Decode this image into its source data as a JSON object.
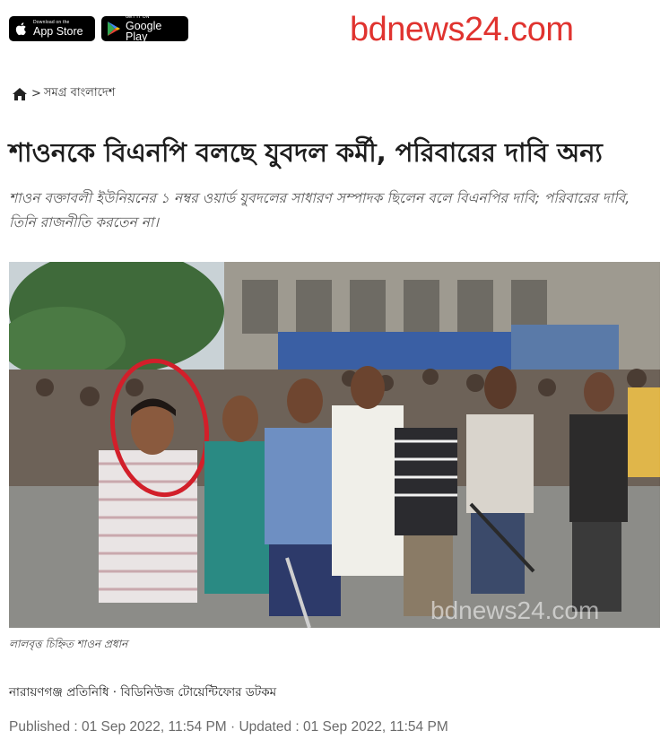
{
  "header": {
    "app_store": {
      "small": "Download on the",
      "big": "App Store"
    },
    "google_play": {
      "small": "GET IT ON",
      "big": "Google Play"
    },
    "logo_text": "bdnews24.com",
    "logo_color": "#e0332f"
  },
  "breadcrumb": {
    "home_icon": "home-icon",
    "separator": ">",
    "section": "সমগ্র বাংলাদেশ"
  },
  "article": {
    "headline": "শাওনকে বিএনপি বলছে যুবদল কর্মী, পরিবারের দাবি অন্য",
    "summary": "শাওন বক্তাবলী ইউনিয়নের ১ নম্বর ওয়ার্ড যুবদলের সাধারণ সম্পাদক ছিলেন বলে বিএনপির দাবি; পরিবারের দাবি, তিনি রাজনীতি করতেন না।",
    "image_watermark": "bdnews24.com",
    "caption": "লালবৃত্ত চিহ্নিত শাওন প্রধান",
    "byline": "নারায়ণগঞ্জ প্রতিনিধি · বিডিনিউজ টোয়েন্টিফোর ডটকম",
    "published_line": "Published : 01 Sep 2022, 11:54 PM · Updated : 01 Sep 2022, 11:54 PM"
  }
}
